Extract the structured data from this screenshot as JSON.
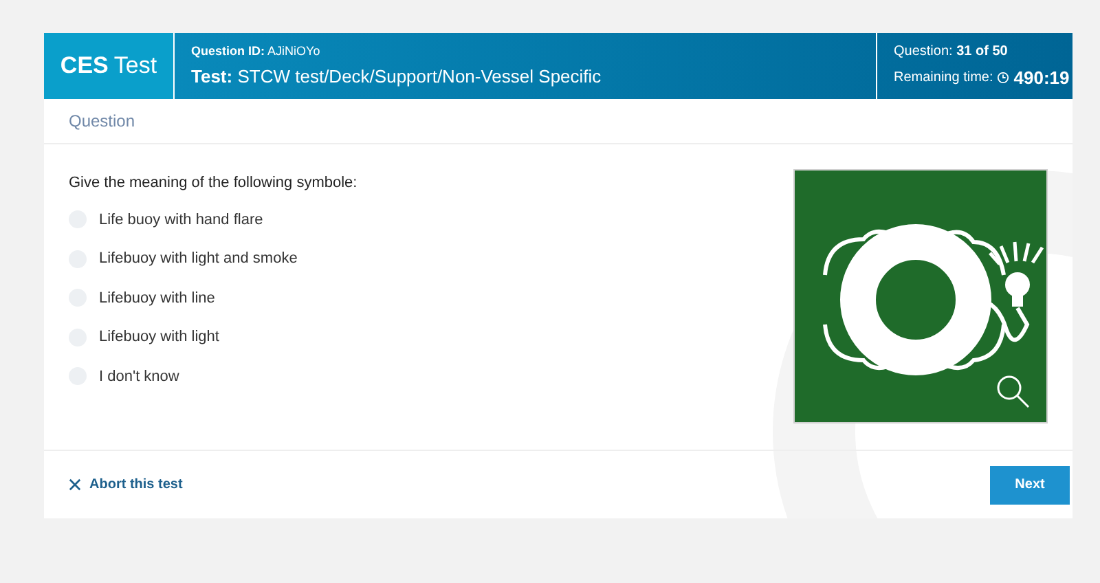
{
  "header": {
    "logo_bold": "CES",
    "logo_light": "Test",
    "question_id_label": "Question ID:",
    "question_id": "AJiNiOYo",
    "test_label": "Test:",
    "test_name": "STCW test/Deck/Support/Non-Vessel Specific",
    "progress_label": "Question:",
    "progress": "31 of 50",
    "time_label": "Remaining time:",
    "time": "490:19"
  },
  "section_title": "Question",
  "question": "Give the meaning of the following symbole:",
  "options": [
    {
      "label": "Life buoy with hand flare",
      "selected": false
    },
    {
      "label": "Lifebuoy with light and smoke",
      "selected": false
    },
    {
      "label": "Lifebuoy with line",
      "selected": false
    },
    {
      "label": "Lifebuoy with light",
      "selected": false
    },
    {
      "label": "I don't know",
      "selected": false
    }
  ],
  "footer": {
    "abort": "Abort this test",
    "next": "Next"
  }
}
